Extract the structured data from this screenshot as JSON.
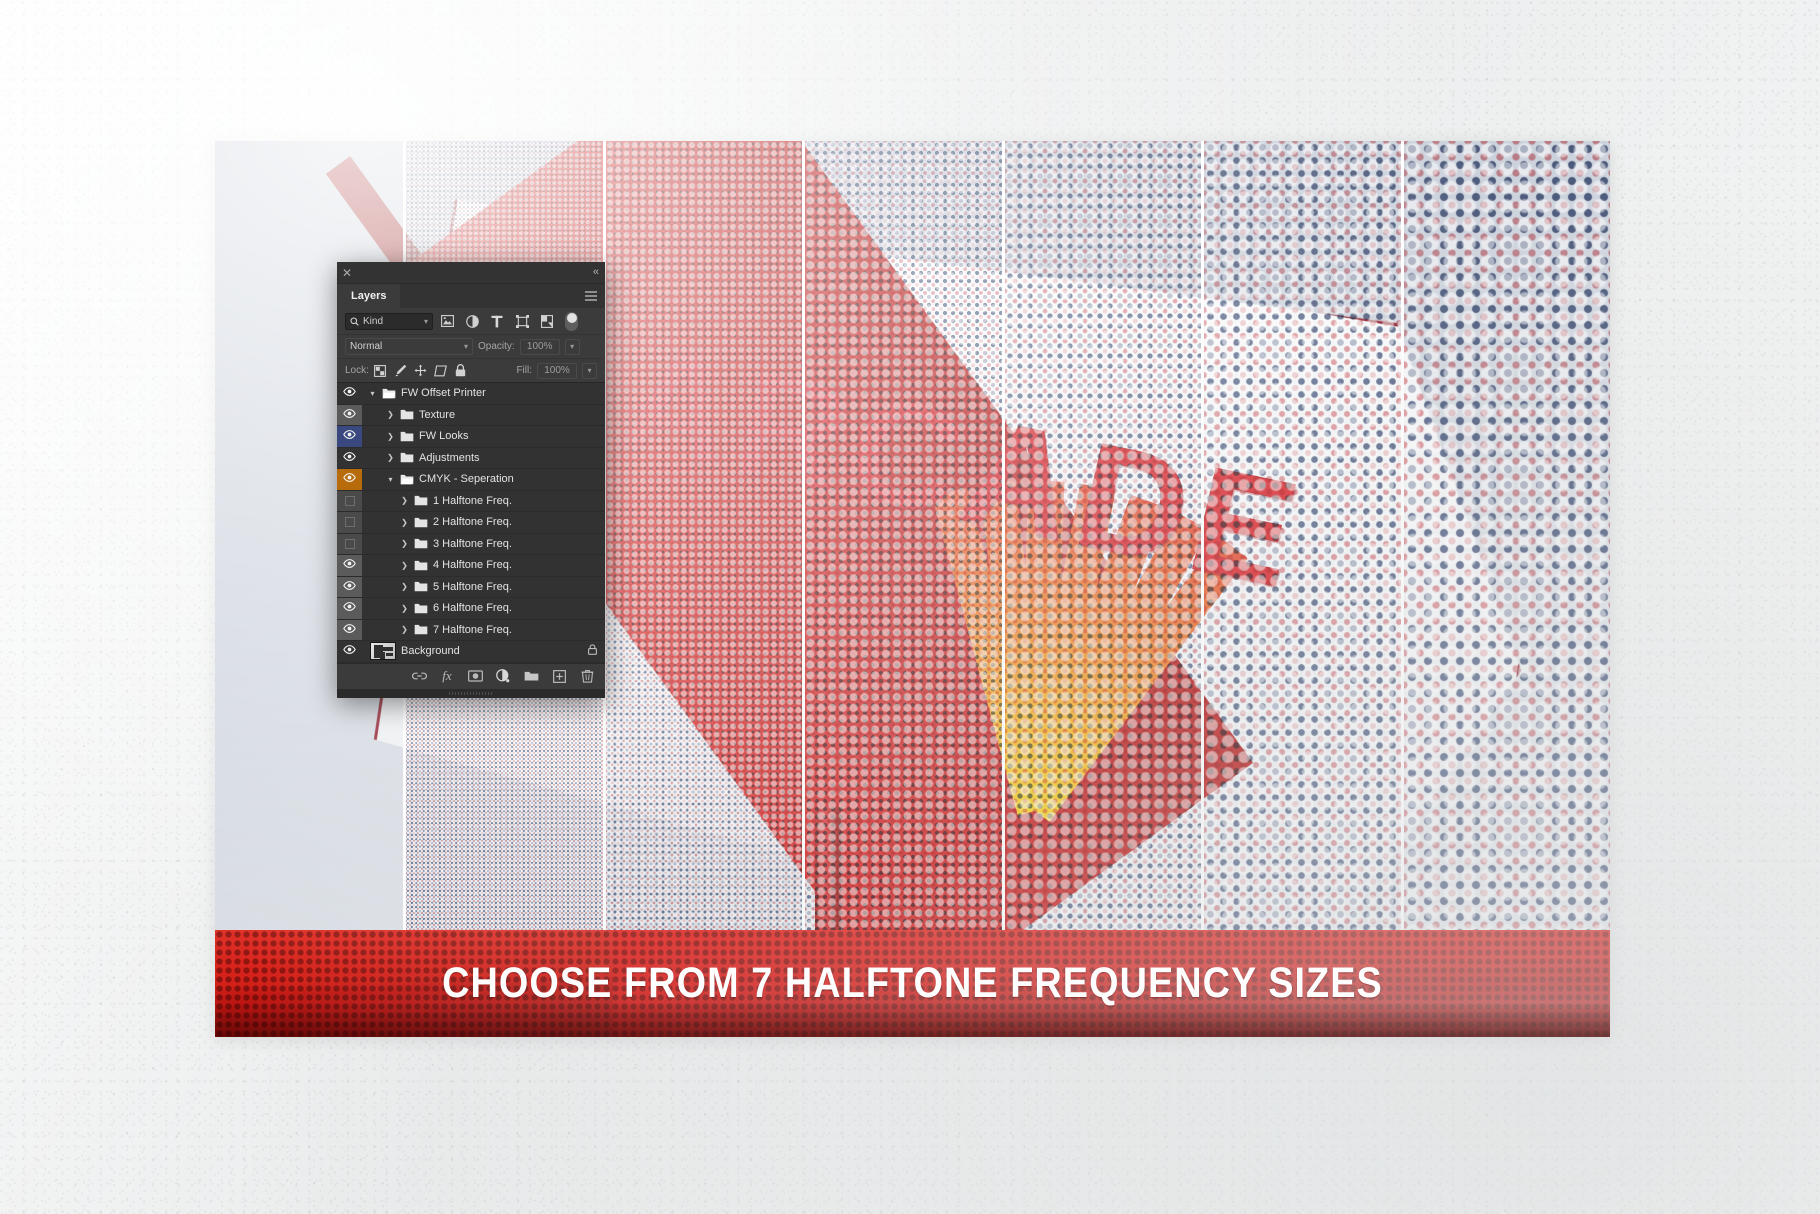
{
  "photo": {
    "alt_description": "Angled retro ARCADE sign photographed against a pale sky, rendered as CMYK halftone separations split into vertical strips of increasing dot frequency",
    "sign_wordmark": "ARCADE",
    "strip_count": 7
  },
  "banner": {
    "text": "CHOOSE FROM 7 HALFTONE FREQUENCY SIZES",
    "background_color": "#d81b17",
    "text_color": "#fdfdfd"
  },
  "panel": {
    "close_icon": "close-icon",
    "collapse_icon": "collapse-double-arrow-icon",
    "menu_icon": "panel-menu-icon",
    "tab_label": "Layers",
    "filter": {
      "kind_label": "Kind",
      "search_icon": "search-icon",
      "chevron": "⌄",
      "icons": [
        {
          "name": "filter-pixel-icon",
          "title": "Pixel layers"
        },
        {
          "name": "filter-adjustment-icon",
          "title": "Adjustment layers"
        },
        {
          "name": "filter-type-icon",
          "title": "Type layers"
        },
        {
          "name": "filter-shape-icon",
          "title": "Shape layers"
        },
        {
          "name": "filter-smartobject-icon",
          "title": "Smart objects"
        }
      ],
      "toggle_name": "filter-enable-toggle"
    },
    "blend": {
      "mode": "Normal",
      "opacity_label": "Opacity:",
      "opacity_value": "100%",
      "fill_label": "Fill:",
      "fill_value": "100%"
    },
    "lock": {
      "label": "Lock:",
      "icons": [
        {
          "name": "lock-transparent-pixels-icon"
        },
        {
          "name": "lock-image-pixels-icon"
        },
        {
          "name": "lock-position-icon"
        },
        {
          "name": "lock-artboard-nesting-icon"
        },
        {
          "name": "lock-all-icon"
        }
      ]
    },
    "layers": [
      {
        "name": "FW Offset Printer",
        "indent": 0,
        "type": "group",
        "expanded": true,
        "visible": true,
        "eye_bg": "none",
        "disclosure": "v"
      },
      {
        "name": "Texture",
        "indent": 1,
        "type": "group",
        "expanded": false,
        "visible": true,
        "eye_bg": "gray",
        "disclosure": ">"
      },
      {
        "name": "FW Looks",
        "indent": 1,
        "type": "group",
        "expanded": false,
        "visible": true,
        "eye_bg": "blue",
        "disclosure": ">"
      },
      {
        "name": "Adjustments",
        "indent": 1,
        "type": "group",
        "expanded": false,
        "visible": true,
        "eye_bg": "none",
        "disclosure": ">"
      },
      {
        "name": "CMYK - Seperation",
        "indent": 1,
        "type": "group",
        "expanded": true,
        "visible": true,
        "eye_bg": "orange",
        "disclosure": "v"
      },
      {
        "name": "1 Halftone Freq.",
        "indent": 2,
        "type": "group",
        "expanded": false,
        "visible": false,
        "eye_bg": "dim",
        "disclosure": ">"
      },
      {
        "name": "2 Halftone Freq.",
        "indent": 2,
        "type": "group",
        "expanded": false,
        "visible": false,
        "eye_bg": "dim",
        "disclosure": ">"
      },
      {
        "name": "3 Halftone Freq.",
        "indent": 2,
        "type": "group",
        "expanded": false,
        "visible": false,
        "eye_bg": "dim",
        "disclosure": ">"
      },
      {
        "name": "4 Halftone Freq.",
        "indent": 2,
        "type": "group",
        "expanded": false,
        "visible": true,
        "eye_bg": "gray",
        "disclosure": ">"
      },
      {
        "name": "5 Halftone Freq.",
        "indent": 2,
        "type": "group",
        "expanded": false,
        "visible": true,
        "eye_bg": "gray",
        "disclosure": ">"
      },
      {
        "name": "6 Halftone Freq.",
        "indent": 2,
        "type": "group",
        "expanded": false,
        "visible": true,
        "eye_bg": "gray",
        "disclosure": ">"
      },
      {
        "name": "7 Halftone Freq.",
        "indent": 2,
        "type": "group",
        "expanded": false,
        "visible": true,
        "eye_bg": "gray",
        "disclosure": ">"
      },
      {
        "name": "Background",
        "indent": 0,
        "type": "raster",
        "expanded": false,
        "visible": true,
        "eye_bg": "none",
        "disclosure": "",
        "locked": true
      }
    ],
    "footer_icons": [
      {
        "name": "link-layers-icon"
      },
      {
        "name": "layer-style-fx-icon"
      },
      {
        "name": "add-layer-mask-icon"
      },
      {
        "name": "new-adjustment-layer-icon"
      },
      {
        "name": "new-group-icon"
      },
      {
        "name": "new-layer-icon"
      },
      {
        "name": "delete-layer-icon"
      }
    ]
  },
  "colors": {
    "panel_bg": "#2b2b2b",
    "panel_row_bg": "#323232",
    "accent_blue": "#39497f",
    "accent_orange": "#b86b0b",
    "banner_red": "#d81b17",
    "sign_red": "#d81f26",
    "ray_yellow": "#f7d11a"
  }
}
